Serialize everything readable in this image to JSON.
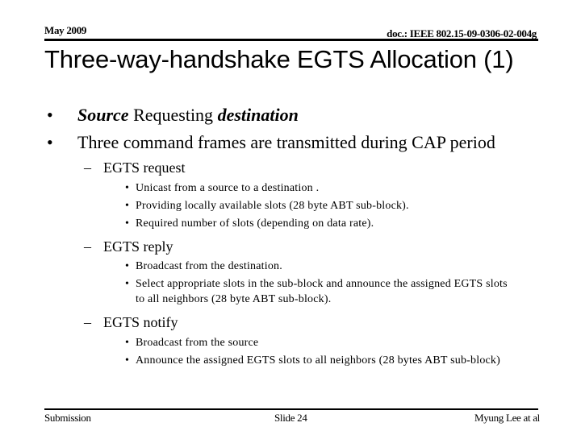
{
  "header": {
    "date": "May 2009",
    "doc_id": "doc.: IEEE 802.15-09-0306-02-004g"
  },
  "title": "Three-way-handshake EGTS Allocation (1)",
  "bullets": [
    {
      "parts": [
        {
          "text": "Source",
          "style": "bold-italic"
        },
        {
          "text": " Requesting ",
          "style": "normal"
        },
        {
          "text": "destination",
          "style": "bold-italic"
        }
      ]
    },
    {
      "text": "Three command frames are transmitted during CAP period",
      "sub": [
        {
          "label": "EGTS request",
          "items": [
            "Unicast from a source to a destination .",
            "Providing locally available slots (28 byte ABT sub-block).",
            "Required number of slots (depending on data rate)."
          ]
        },
        {
          "label": "EGTS reply",
          "items": [
            "Broadcast from the destination.",
            "Select appropriate slots in the sub-block and announce the assigned EGTS slots",
            "to all neighbors (28 byte ABT sub-block)."
          ]
        },
        {
          "label": "EGTS notify",
          "items": [
            "Broadcast from the source",
            "Announce the assigned EGTS slots to all neighbors (28 bytes ABT sub-block)"
          ]
        }
      ]
    }
  ],
  "symbols": {
    "bullet": "•",
    "dash": "–"
  },
  "footer": {
    "left": "Submission",
    "center": "Slide 24",
    "right": "Myung Lee at al"
  }
}
